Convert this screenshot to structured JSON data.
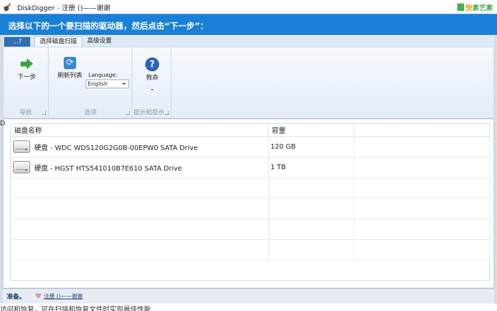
{
  "window": {
    "title": "DiskDigger - 注册 ()——谢谢",
    "watermark_a": "快",
    "watermark_b": "素艺素"
  },
  "banner": {
    "text": "选择以下的一个要扫描的驱动器，然后点击“下一步”："
  },
  "ribbon_tabs": {
    "app_tab": "...?",
    "tabs": [
      "选择磁盘扫描",
      "高级设置"
    ],
    "active_index": 0
  },
  "ribbon": {
    "groups": {
      "nav": {
        "label": "导航",
        "next_label": "下一步"
      },
      "options": {
        "label": "选项",
        "refresh_label": "刷新列表",
        "language_label": "Language:",
        "language_value": "English"
      },
      "help": {
        "label": "提示和提示...",
        "help_label": "救命"
      }
    }
  },
  "table": {
    "columns": [
      "磁盘名称",
      "容量",
      ""
    ],
    "rows": [
      {
        "name": "硬盘 - WDC WDS120G2G0B-00EPW0 SATA Drive",
        "capacity": "120 GB"
      },
      {
        "name": "硬盘 - HGST HTS541010B7E610 SATA Drive",
        "capacity": "1 TB"
      }
    ]
  },
  "status": {
    "text": "准备。",
    "register_link": "注册 ()——谢谢"
  },
  "background": {
    "left_char": "D",
    "bottom_text": "访问和恢复，可在扫描和恢复文件时实现最佳性能"
  },
  "colors": {
    "banner": "#1a7fd6",
    "ribbon_app_tab": "#2f6fb4",
    "status_text": "#1b3c6b"
  },
  "icons": {
    "app": "shovel-icon",
    "next": "green-arrow-icon",
    "refresh": "refresh-icon",
    "help": "help-icon",
    "drive": "hard-drive-icon",
    "register": "heart-icon"
  }
}
